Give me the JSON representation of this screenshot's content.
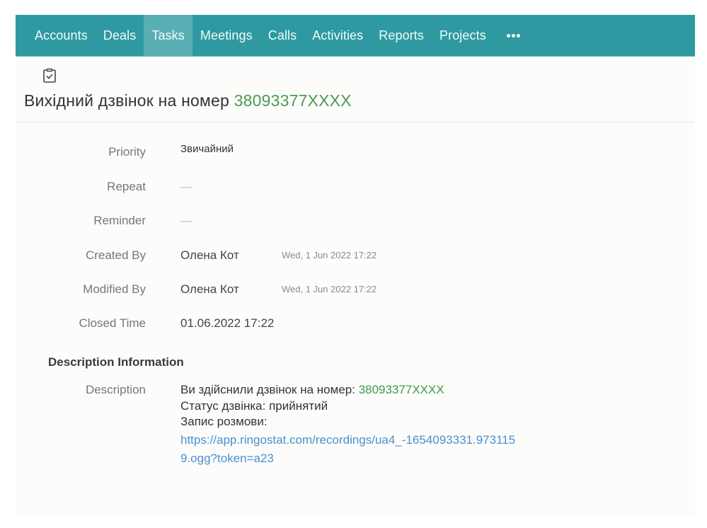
{
  "nav": {
    "items": [
      {
        "label": "Accounts",
        "active": false
      },
      {
        "label": "Deals",
        "active": false
      },
      {
        "label": "Tasks",
        "active": true
      },
      {
        "label": "Meetings",
        "active": false
      },
      {
        "label": "Calls",
        "active": false
      },
      {
        "label": "Activities",
        "active": false
      },
      {
        "label": "Reports",
        "active": false
      },
      {
        "label": "Projects",
        "active": false
      }
    ],
    "more_icon": "more-horizontal-icon"
  },
  "record": {
    "icon": "clipboard-check-icon",
    "title_text": "Вихідний дзвінок на номер",
    "title_phone": "38093377XXXX"
  },
  "fields": [
    {
      "label": "Priority",
      "value": "Звичайний"
    },
    {
      "label": "Repeat",
      "value": "—"
    },
    {
      "label": "Reminder",
      "value": "—"
    },
    {
      "label": "Created By",
      "value": "Олена Кот",
      "meta": "Wed, 1 Jun 2022 17:22"
    },
    {
      "label": "Modified By",
      "value": "Олена Кот",
      "meta": "Wed, 1 Jun 2022 17:22"
    },
    {
      "label": "Closed Time",
      "value": "01.06.2022 17:22"
    }
  ],
  "description_section": {
    "heading": "Description Information",
    "label": "Description",
    "line1_text": "Ви здійснили дзвінок на номер:",
    "line1_phone": "38093377XXXX",
    "line2": "Статус дзвінка: прийнятий",
    "line3": "Запис розмови:",
    "link": "https://app.ringostat.com/recordings/ua4_-1654093331.9731159.ogg?token=a23"
  },
  "colors": {
    "nav_bg": "#2e99a0",
    "nav_active_bg": "#5aafb4",
    "phone_green": "#4c9a50",
    "link_blue": "#4a90d0"
  }
}
